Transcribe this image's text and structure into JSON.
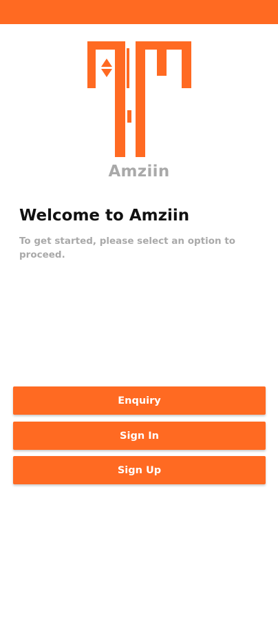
{
  "theme": {
    "accent": "#FF6A22",
    "muted_text": "#A9A9A9",
    "primary_text": "#111111"
  },
  "logo": {
    "icon": "amziin-logo-icon",
    "name": "Amziin"
  },
  "welcome": {
    "title": "Welcome to Amziin",
    "subtitle": "To get started, please select an option to proceed."
  },
  "actions": {
    "enquiry_label": "Enquiry",
    "signin_label": "Sign In",
    "signup_label": "Sign Up"
  }
}
